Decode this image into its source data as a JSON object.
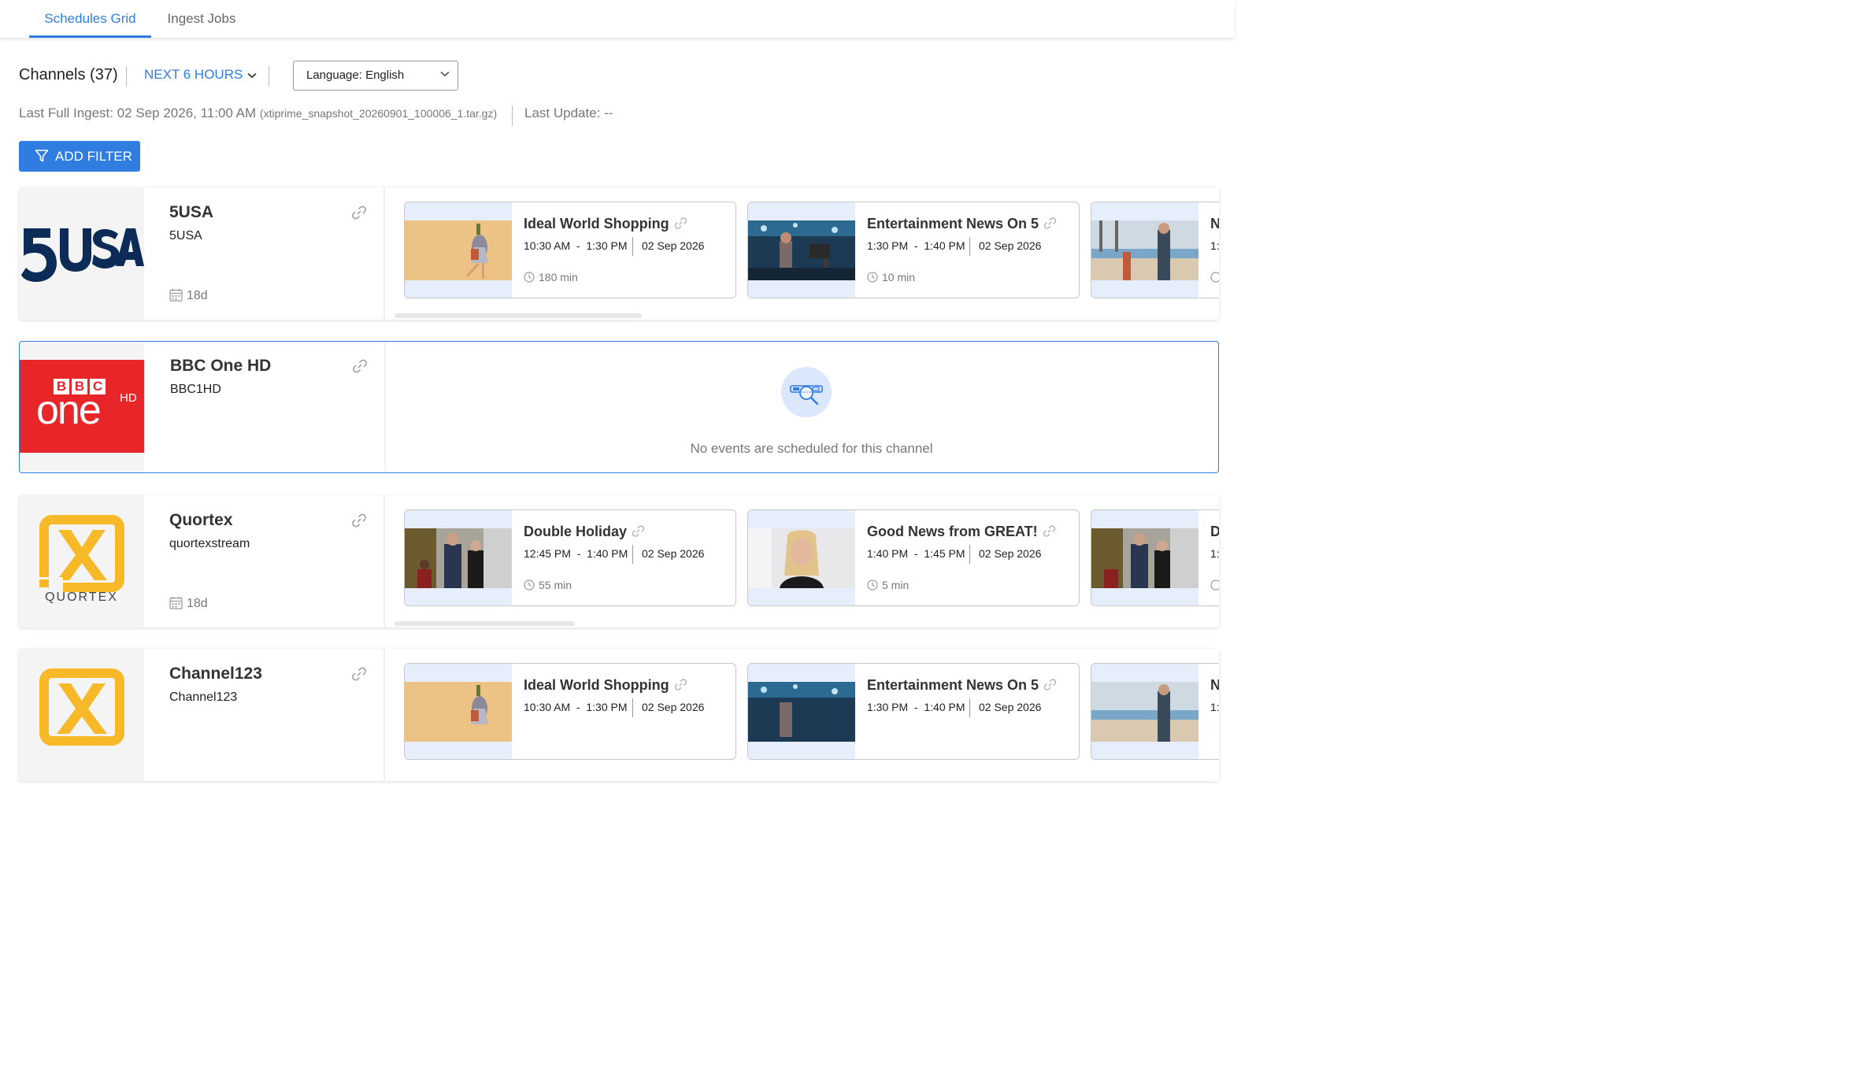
{
  "tabs": [
    {
      "label": "Schedules Grid",
      "active": true
    },
    {
      "label": "Ingest Jobs",
      "active": false
    }
  ],
  "toolbar": {
    "channels_title": "Channels (37)",
    "range_label": "NEXT 6 HOURS",
    "language_select": "Language: English"
  },
  "ingest": {
    "last_full_ingest": "Last Full Ingest: 02 Sep 2026, 11:00 AM",
    "file": "(xtiprime_snapshot_20260901_100006_1.tar.gz)",
    "last_update": "Last Update: --"
  },
  "add_filter_label": "ADD FILTER",
  "accent_color": "#2f7de1",
  "channels": [
    {
      "name": "5USA",
      "id": "5USA",
      "days": "18d",
      "logo": "5usa-logo",
      "events": [
        {
          "title": "Ideal World Shopping",
          "time": "10:30 AM  -  1:30 PM",
          "date": "02 Sep 2026",
          "duration": "180 min"
        },
        {
          "title": "Entertainment News On 5",
          "time": "1:30 PM  -  1:40 PM",
          "date": "02 Sep 2026",
          "duration": "10 min"
        },
        {
          "title": "N",
          "time": "1:",
          "date": "",
          "duration": ""
        }
      ]
    },
    {
      "name": "BBC One HD",
      "id": "BBC1HD",
      "days": "",
      "logo": "bbc-one-hd-logo",
      "logo_text": {
        "bbc": "BBC",
        "one": "one",
        "hd": "HD"
      },
      "empty_message": "No events are scheduled for this channel",
      "events": []
    },
    {
      "name": "Quortex",
      "id": "quortexstream",
      "days": "18d",
      "logo": "quortex-logo",
      "logo_text": "QUORTEX",
      "events": [
        {
          "title": "Double Holiday",
          "time": "12:45 PM  -  1:40 PM",
          "date": "02 Sep 2026",
          "duration": "55 min"
        },
        {
          "title": "Good News from GREAT!",
          "time": "1:40 PM  -  1:45 PM",
          "date": "02 Sep 2026",
          "duration": "5 min"
        },
        {
          "title": "D",
          "time": "1:",
          "date": "",
          "duration": ""
        }
      ]
    },
    {
      "name": "Channel123",
      "id": "Channel123",
      "days": "",
      "logo": "quortex-logo",
      "events": [
        {
          "title": "Ideal World Shopping",
          "time": "10:30 AM  -  1:30 PM",
          "date": "02 Sep 2026",
          "duration": ""
        },
        {
          "title": "Entertainment News On 5",
          "time": "1:30 PM  -  1:40 PM",
          "date": "02 Sep 2026",
          "duration": ""
        },
        {
          "title": "N",
          "time": "1:",
          "date": "",
          "duration": ""
        }
      ]
    }
  ]
}
